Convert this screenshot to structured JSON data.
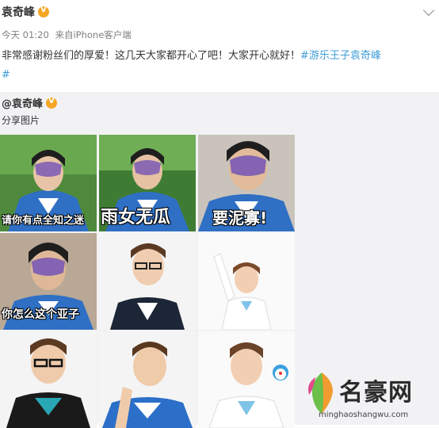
{
  "post": {
    "author": "袁奇峰",
    "time": "今天 01:20",
    "source_prefix": "来自",
    "source": "iPhone客户端",
    "text": "非常感谢粉丝们的厚爱！这几天大家都开心了吧！大家开心就好！",
    "hashtag_line1": "#游乐王子袁奇峰",
    "hashtag_line2": "#"
  },
  "repost": {
    "author": "@袁奇峰",
    "text": "分享图片",
    "images": [
      {
        "caption": "请你有点全知之迷",
        "icon": "photo-icon"
      },
      {
        "caption": "雨女无瓜",
        "icon": "photo-icon"
      },
      {
        "caption": "要泥寡!",
        "icon": "photo-icon"
      },
      {
        "caption": "你怎么这个亚子",
        "icon": "photo-icon"
      },
      {
        "caption": "",
        "icon": "photo-icon"
      },
      {
        "caption": "",
        "icon": "photo-icon"
      },
      {
        "caption": "",
        "icon": "photo-icon"
      },
      {
        "caption": "",
        "icon": "photo-icon"
      },
      {
        "caption": "",
        "icon": "photo-icon"
      }
    ]
  },
  "watermark": {
    "name": "名豪网",
    "url": "minghaoshangwu.com"
  },
  "colors": {
    "hashtag": "#3e9dd8",
    "badge": "#f5a623",
    "repost_bg": "#f2f2f5",
    "meta": "#808080"
  }
}
